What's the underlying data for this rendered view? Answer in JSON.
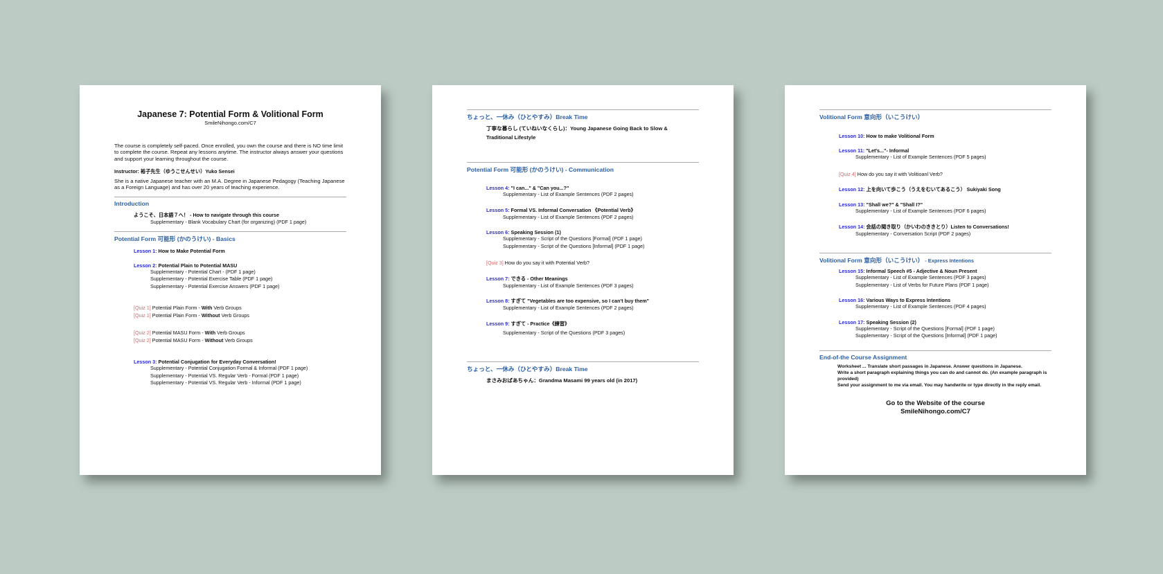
{
  "page1": {
    "title": "Japanese 7: Potential Form & Volitional Form",
    "url": "SmileNihongo.com/C7",
    "intro_para": "The course is completely self-paced. Once enrolled, you own the course and there is NO time limit to complete the course. Repeat any lessons anytime. The instructor always answer your questions and support your learning throughout the course.",
    "instructor": "Instructor:  裕子先生（ゆうこせんせい）Yuko Sensei",
    "bio": "She is a native Japanese teacher with an M.A. Degree in Japanese Pedagogy (Teaching Japanese as a Foreign Language) and has over 20 years of teaching experience.",
    "sec_intro": "Introduction",
    "intro_line": "ようこそ、日本語７へ！ - How to navigate through this course",
    "intro_supp": "Supplementary - Blank Vocabulary Chart (for organizing) (PDF 1 page)",
    "sec_basics": "Potential Form 可能形 (かのうけい) - Basics",
    "l1": {
      "n": "Lesson 1:",
      "t": " How to Make Potential Form"
    },
    "l2": {
      "n": "Lesson 2:",
      "t": " Potential Plain to Potential MASU"
    },
    "l2s": [
      "Supplementary - Potential Chart - (PDF 1 page)",
      "Supplementary - Potential Exercise Table (PDF 1 page)",
      "Supplementary - Potential Exercise Answers (PDF 1 page)"
    ],
    "q1a": {
      "n": "[Quiz 1]",
      "a": " Potential Plain Form - ",
      "b": "With",
      "c": " Verb Groups"
    },
    "q1b": {
      "n": "[Quiz 1]",
      "a": " Potential Plain Form - ",
      "b": "Without",
      "c": " Verb Groups"
    },
    "q2a": {
      "n": "[Quiz 2]",
      "a": " Potential MASU Form - ",
      "b": "With",
      "c": " Verb Groups"
    },
    "q2b": {
      "n": "[Quiz 2]",
      "a": " Potential MASU Form - ",
      "b": "Without",
      "c": " Verb Groups"
    },
    "l3": {
      "n": "Lesson 3:",
      "t": " Potential Conjugation for Everyday Conversation!"
    },
    "l3s": [
      "Supplementary - Potential Conjugation Formal & Informal (PDF 1 page)",
      "Supplementary - Potential VS. Regular Verb - Formal (PDF 1 page)",
      "Supplementary - Potential VS. Regular Verb - Informal (PDF 1 page)"
    ]
  },
  "page2": {
    "sec_break1": "ちょっと、一休み（ひとやすみ）Break Time",
    "break1_a": "丁寧な暮らし (ていねいなくらし)：Young Japanese Going Back to Slow &",
    "break1_b": "Traditional Lifestyle",
    "sec_comm": "Potential Form 可能形 (かのうけい) - Communication",
    "l4": {
      "n": "Lesson 4:",
      "t": " \"I can...\" & \"Can you...?\""
    },
    "l4s": "Supplementary - List of Example Sentences (PDF 2 pages)",
    "l5": {
      "n": "Lesson 5:",
      "t": " Formal VS. Informal Conversation 《Potential Verb》"
    },
    "l5s": "Supplementary - List of Example Sentences (PDF 2 pages)",
    "l6": {
      "n": "Lesson 6:",
      "t": " Speaking Session (1)"
    },
    "l6s": [
      "Supplementary -  Script of the Questions [Formal] (PDF 1 page)",
      "Supplementary -  Script of the Questions [Informal] (PDF 1 page)"
    ],
    "q3": {
      "n": "[Quiz 3]",
      "a": " How do you say it with Potential Verb?"
    },
    "l7": {
      "n": "Lesson 7:",
      "t": " できる - Other Meanings"
    },
    "l7s": "Supplementary - List of Example Sentences (PDF 3 pages)",
    "l8": {
      "n": "Lesson 8:",
      "t": " すぎて \"Vegetables are too expensive, so I can't buy them\""
    },
    "l8s": "Supplementary - List of Example Sentences (PDF 2 pages)",
    "l9": {
      "n": "Lesson 9:",
      "t": " すぎて - Practice《練習》"
    },
    "l9s": "Supplementary -  Script of the Questions (PDF 3 pages)",
    "sec_break2": "ちょっと、一休み（ひとやすみ）Break Time",
    "break2": "まさみおばあちゃん：Grandma Masami 99 years old (in 2017)"
  },
  "page3": {
    "sec_vol": "Volitional Form 意向形（いこうけい）",
    "l10": {
      "n": "Lesson 10:",
      "t": " How to make Volitional Form"
    },
    "l11": {
      "n": "Lesson 11:",
      "t": " \"Let's...\"- Informal"
    },
    "l11s": "Supplementary - List of Example Sentences (PDF 5 pages)",
    "q4": {
      "n": "[Quiz 4]",
      "a": " How do you say it with Volitioanl Verb?"
    },
    "l12": {
      "n": "Lesson 12:",
      "t": " 上を向いて歩こう（うえをむいてあるこう） Sukiyaki Song"
    },
    "l13": {
      "n": "Lesson 13:",
      "t": " \"Shall we?\" & \"Shall I?\""
    },
    "l13s": "Supplementary - List of Example Sentences (PDF 6 pages)",
    "l14": {
      "n": "Lesson 14:",
      "t": " 会話の聞き取り（かいわのききとり）Listen to Conversations!"
    },
    "l14s": "Supplementary - Conversation Script (PDF 2 pages)",
    "sec_express": "Volitional Form 意向形（いこうけい）",
    "sec_express_small": " - Express Intentions",
    "l15": {
      "n": "Lesson 15:",
      "t": " Informal Speech #5 -  Adjective & Noun Present"
    },
    "l15s": [
      "Supplementary - List of Example Sentences (PDF 3 pages)",
      "Supplementary - List of Verbs for Future Plans (PDF 1 page)"
    ],
    "l16": {
      "n": "Lesson 16:",
      "t": " Various Ways to Express Intentions"
    },
    "l16s": "Supplementary - List of Example Sentences (PDF 4 pages)",
    "l17": {
      "n": "Lesson 17:",
      "t": " Speaking Session (2)"
    },
    "l17s": [
      "Supplementary -  Script of the Questions [Formal] (PDF 1 page)",
      "Supplementary -  Script of the Questions [Informal] (PDF 1 page)"
    ],
    "sec_end": "End-of-the Course Assignment",
    "ws1": "Worksheet ... Translate short passages in Japanese. Answer questions in Japanese.",
    "ws2": "Write a short paragraph explaining things you can do and cannot do. (An example paragraph is provided)",
    "ws3": "Send your assignment to me via email. You may handwrite or type directly in the reply email.",
    "go1": "Go to the Website of the course",
    "go2": "SmileNihongo.com/C7"
  }
}
